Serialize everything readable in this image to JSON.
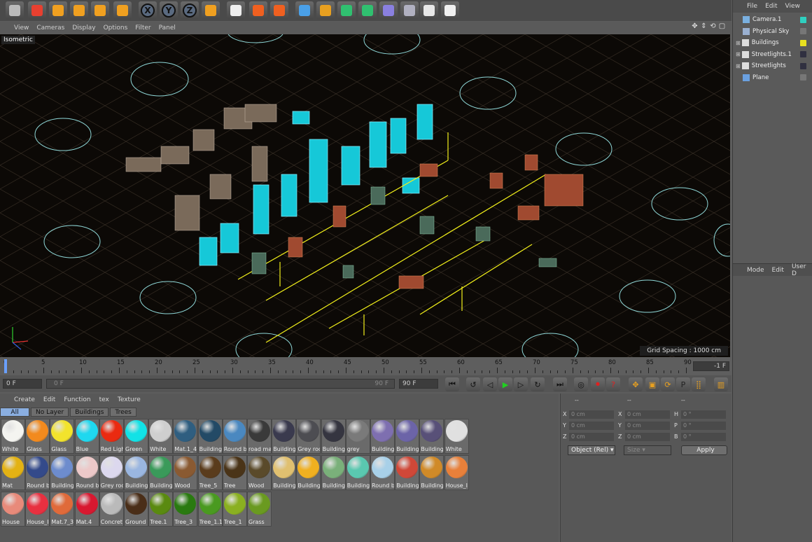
{
  "toolbar": {
    "buttons": [
      {
        "icon": "undo-icon"
      },
      {
        "icon": "select-icon"
      },
      {
        "icon": "move-icon"
      },
      {
        "icon": "scale-icon"
      },
      {
        "icon": "rotate-icon"
      },
      {
        "icon": "last-tool-icon"
      },
      {
        "icon": "x-axis-icon",
        "text": "X"
      },
      {
        "icon": "y-axis-icon",
        "text": "Y"
      },
      {
        "icon": "z-axis-icon",
        "text": "Z"
      },
      {
        "icon": "coordinate-system-icon"
      },
      {
        "icon": "render-view-icon"
      },
      {
        "icon": "render-picture-viewer-icon"
      },
      {
        "icon": "render-settings-icon"
      },
      {
        "icon": "cube-icon"
      },
      {
        "icon": "pen-icon"
      },
      {
        "icon": "subdivision-icon"
      },
      {
        "icon": "array-icon"
      },
      {
        "icon": "deformer-icon"
      },
      {
        "icon": "floor-icon"
      },
      {
        "icon": "camera-icon"
      },
      {
        "icon": "light-icon"
      }
    ]
  },
  "viewport": {
    "menu": [
      "View",
      "Cameras",
      "Display",
      "Options",
      "Filter",
      "Panel"
    ],
    "label": "Isometric",
    "grid_spacing": "Grid Spacing : 1000 cm"
  },
  "timeline": {
    "ticks": [
      "0",
      "5",
      "10",
      "15",
      "20",
      "25",
      "30",
      "35",
      "40",
      "45",
      "50",
      "55",
      "60",
      "65",
      "70",
      "75",
      "80",
      "85",
      "90"
    ],
    "current_frame": "-1 F",
    "start_field": "0 F",
    "range_start": "0 F",
    "range_end": "90 F",
    "end_field": "90 F"
  },
  "materials": {
    "menu": [
      "Create",
      "Edit",
      "Function",
      "tex",
      "Texture"
    ],
    "tabs": [
      "All",
      "No Layer",
      "Buildings",
      "Trees"
    ],
    "active_tab": "All",
    "rows": [
      [
        {
          "name": "White",
          "color": "#f4f4f0"
        },
        {
          "name": "Glass",
          "color": "#f28a1e"
        },
        {
          "name": "Glass",
          "color": "#f2e32c"
        },
        {
          "name": "Blue",
          "color": "#1fd8ef"
        },
        {
          "name": "Red Ligh",
          "color": "#ea2a10"
        },
        {
          "name": "Green",
          "color": "#12e2e6"
        },
        {
          "name": "White",
          "color": "#cfcfcf"
        },
        {
          "name": "Mat.1_4",
          "color": "#2f5e80"
        },
        {
          "name": "Building",
          "color": "#234a66"
        },
        {
          "name": "Round b",
          "color": "#4a88c0"
        },
        {
          "name": "road ma",
          "color": "#3a3a3a"
        },
        {
          "name": "Building",
          "color": "#3a3a4e"
        },
        {
          "name": "Grey roo",
          "color": "#4d4d52"
        },
        {
          "name": "Building",
          "color": "#353540"
        },
        {
          "name": "grey",
          "color": "#7a7a7a"
        },
        {
          "name": "Building",
          "color": "#7e6fb0"
        },
        {
          "name": "Building",
          "color": "#6c64a8"
        },
        {
          "name": "Building",
          "color": "#585078"
        },
        {
          "name": "White",
          "color": "#e0e0e0"
        }
      ],
      [
        {
          "name": "Mat",
          "color": "#e3b214"
        },
        {
          "name": "Round b",
          "color": "#344a8a"
        },
        {
          "name": "Building",
          "color": "#6d8ccd"
        },
        {
          "name": "Round b",
          "color": "#ecc8c8"
        },
        {
          "name": "Grey roo",
          "color": "#dcd8ee"
        },
        {
          "name": "Building",
          "color": "#9ab6e0"
        },
        {
          "name": "Building",
          "color": "#3a9a5a"
        },
        {
          "name": "Wood",
          "color": "#8a5a32"
        },
        {
          "name": "Tree_5",
          "color": "#5a3c1c"
        },
        {
          "name": "Tree",
          "color": "#4a3418"
        },
        {
          "name": "Wood",
          "color": "#5a4a2a"
        },
        {
          "name": "Building",
          "color": "#e0c070"
        },
        {
          "name": "Building",
          "color": "#f0b020"
        },
        {
          "name": "Building",
          "color": "#7ab07a"
        },
        {
          "name": "Building",
          "color": "#5ac8b0"
        },
        {
          "name": "Round b",
          "color": "#a8d0e8"
        },
        {
          "name": "Building",
          "color": "#d04838"
        },
        {
          "name": "Building",
          "color": "#d08a28"
        },
        {
          "name": "House_I",
          "color": "#e8803a"
        }
      ],
      [
        {
          "name": "House",
          "color": "#e88a7a"
        },
        {
          "name": "House_I",
          "color": "#e83040"
        },
        {
          "name": "Mat.7_3",
          "color": "#e06a3a"
        },
        {
          "name": "Mat.4",
          "color": "#d81830"
        },
        {
          "name": "Concret",
          "color": "#bababa"
        },
        {
          "name": "Ground",
          "color": "#4a2e18"
        },
        {
          "name": "Tree.1",
          "color": "#5a8a10"
        },
        {
          "name": "Tree_3",
          "color": "#2a7a10"
        },
        {
          "name": "Tree_1.1",
          "color": "#4a9a20"
        },
        {
          "name": "Tree_1",
          "color": "#8ab020"
        },
        {
          "name": "Grass",
          "color": "#6a9a20"
        }
      ]
    ]
  },
  "coords": {
    "headers": [
      "--",
      "--",
      "--"
    ],
    "rows": [
      {
        "a": "X",
        "v1": "0 cm",
        "b": "X",
        "v2": "0 cm",
        "c": "H",
        "v3": "0 °"
      },
      {
        "a": "Y",
        "v1": "0 cm",
        "b": "Y",
        "v2": "0 cm",
        "c": "P",
        "v3": "0 °"
      },
      {
        "a": "Z",
        "v1": "0 cm",
        "b": "Z",
        "v2": "0 cm",
        "c": "B",
        "v3": "0 °"
      }
    ],
    "mode_select": "Object (Rel)",
    "size_select": "Size",
    "apply": "Apply"
  },
  "objects": {
    "menu": [
      "File",
      "Edit",
      "View"
    ],
    "items": [
      {
        "name": "Camera.1",
        "icon": "camera-icon",
        "tag": "#2fd0c0"
      },
      {
        "name": "Physical Sky",
        "icon": "sky-icon",
        "tag": ""
      },
      {
        "name": "Buildings",
        "icon": "null-icon",
        "tag": "#e8e020"
      },
      {
        "name": "Streetlights.1",
        "icon": "null-icon",
        "tag": "#303040"
      },
      {
        "name": "Streetlights",
        "icon": "null-icon",
        "tag": "#303040"
      },
      {
        "name": "Plane",
        "icon": "plane-icon",
        "tag": ""
      }
    ]
  },
  "attributes": {
    "menu": [
      "Mode",
      "Edit",
      "User D"
    ]
  }
}
